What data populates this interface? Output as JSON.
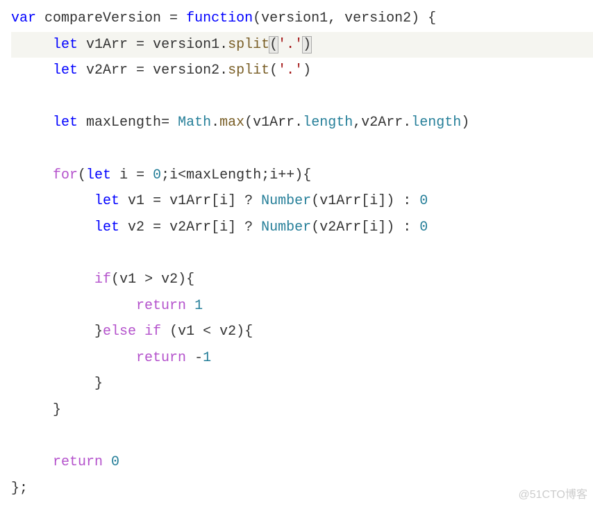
{
  "watermark": "@51CTO博客",
  "code": [
    {
      "indent": 0,
      "segs": [
        {
          "cls": "kw-var",
          "t": "var"
        },
        {
          "cls": "ident",
          "t": " compareVersion "
        },
        {
          "cls": "op",
          "t": "="
        },
        {
          "cls": "ident",
          "t": " "
        },
        {
          "cls": "kw-function",
          "t": "function"
        },
        {
          "cls": "paren",
          "t": "("
        },
        {
          "cls": "ident",
          "t": "version1"
        },
        {
          "cls": "punct",
          "t": ", "
        },
        {
          "cls": "ident",
          "t": "version2"
        },
        {
          "cls": "paren",
          "t": ") "
        },
        {
          "cls": "brace",
          "t": "{"
        }
      ]
    },
    {
      "indent": 1,
      "hl": true,
      "segs": [
        {
          "cls": "kw-let",
          "t": "let"
        },
        {
          "cls": "ident",
          "t": " v1Arr "
        },
        {
          "cls": "op",
          "t": "="
        },
        {
          "cls": "ident",
          "t": " version1"
        },
        {
          "cls": "punct",
          "t": "."
        },
        {
          "cls": "method",
          "t": "split"
        },
        {
          "cls": "paren hlp",
          "t": "("
        },
        {
          "cls": "str",
          "t": "'.'"
        },
        {
          "cls": "paren hlp",
          "t": ")"
        }
      ]
    },
    {
      "indent": 1,
      "segs": [
        {
          "cls": "kw-let",
          "t": "let"
        },
        {
          "cls": "ident",
          "t": " v2Arr "
        },
        {
          "cls": "op",
          "t": "="
        },
        {
          "cls": "ident",
          "t": " version2"
        },
        {
          "cls": "punct",
          "t": "."
        },
        {
          "cls": "method",
          "t": "split"
        },
        {
          "cls": "paren",
          "t": "("
        },
        {
          "cls": "str",
          "t": "'.'"
        },
        {
          "cls": "paren",
          "t": ")"
        }
      ]
    },
    {
      "indent": 0,
      "segs": [
        {
          "cls": "",
          "t": " "
        }
      ]
    },
    {
      "indent": 1,
      "segs": [
        {
          "cls": "kw-let",
          "t": "let"
        },
        {
          "cls": "ident",
          "t": " maxLength"
        },
        {
          "cls": "op",
          "t": "="
        },
        {
          "cls": "ident",
          "t": " "
        },
        {
          "cls": "var",
          "t": "Math"
        },
        {
          "cls": "punct",
          "t": "."
        },
        {
          "cls": "method",
          "t": "max"
        },
        {
          "cls": "paren",
          "t": "("
        },
        {
          "cls": "ident",
          "t": "v1Arr"
        },
        {
          "cls": "punct",
          "t": "."
        },
        {
          "cls": "prop",
          "t": "length"
        },
        {
          "cls": "punct",
          "t": ","
        },
        {
          "cls": "ident",
          "t": "v2Arr"
        },
        {
          "cls": "punct",
          "t": "."
        },
        {
          "cls": "prop",
          "t": "length"
        },
        {
          "cls": "paren",
          "t": ")"
        }
      ]
    },
    {
      "indent": 0,
      "segs": [
        {
          "cls": "",
          "t": " "
        }
      ]
    },
    {
      "indent": 1,
      "segs": [
        {
          "cls": "kw-for",
          "t": "for"
        },
        {
          "cls": "paren",
          "t": "("
        },
        {
          "cls": "kw-let",
          "t": "let"
        },
        {
          "cls": "ident",
          "t": " i "
        },
        {
          "cls": "op",
          "t": "="
        },
        {
          "cls": "ident",
          "t": " "
        },
        {
          "cls": "num",
          "t": "0"
        },
        {
          "cls": "punct",
          "t": ";"
        },
        {
          "cls": "ident",
          "t": "i"
        },
        {
          "cls": "op",
          "t": "<"
        },
        {
          "cls": "ident",
          "t": "maxLength"
        },
        {
          "cls": "punct",
          "t": ";"
        },
        {
          "cls": "ident",
          "t": "i"
        },
        {
          "cls": "op",
          "t": "++"
        },
        {
          "cls": "paren",
          "t": ")"
        },
        {
          "cls": "brace",
          "t": "{"
        }
      ]
    },
    {
      "indent": 2,
      "segs": [
        {
          "cls": "kw-let",
          "t": "let"
        },
        {
          "cls": "ident",
          "t": " v1 "
        },
        {
          "cls": "op",
          "t": "="
        },
        {
          "cls": "ident",
          "t": " v1Arr"
        },
        {
          "cls": "paren",
          "t": "["
        },
        {
          "cls": "ident",
          "t": "i"
        },
        {
          "cls": "paren",
          "t": "] "
        },
        {
          "cls": "op",
          "t": "?"
        },
        {
          "cls": "ident",
          "t": " "
        },
        {
          "cls": "func-call",
          "t": "Number"
        },
        {
          "cls": "paren",
          "t": "("
        },
        {
          "cls": "ident",
          "t": "v1Arr"
        },
        {
          "cls": "paren",
          "t": "["
        },
        {
          "cls": "ident",
          "t": "i"
        },
        {
          "cls": "paren",
          "t": "]) "
        },
        {
          "cls": "op",
          "t": ":"
        },
        {
          "cls": "ident",
          "t": " "
        },
        {
          "cls": "num",
          "t": "0"
        }
      ]
    },
    {
      "indent": 2,
      "segs": [
        {
          "cls": "kw-let",
          "t": "let"
        },
        {
          "cls": "ident",
          "t": " v2 "
        },
        {
          "cls": "op",
          "t": "="
        },
        {
          "cls": "ident",
          "t": " v2Arr"
        },
        {
          "cls": "paren",
          "t": "["
        },
        {
          "cls": "ident",
          "t": "i"
        },
        {
          "cls": "paren",
          "t": "] "
        },
        {
          "cls": "op",
          "t": "?"
        },
        {
          "cls": "ident",
          "t": " "
        },
        {
          "cls": "func-call",
          "t": "Number"
        },
        {
          "cls": "paren",
          "t": "("
        },
        {
          "cls": "ident",
          "t": "v2Arr"
        },
        {
          "cls": "paren",
          "t": "["
        },
        {
          "cls": "ident",
          "t": "i"
        },
        {
          "cls": "paren",
          "t": "]) "
        },
        {
          "cls": "op",
          "t": ":"
        },
        {
          "cls": "ident",
          "t": " "
        },
        {
          "cls": "num",
          "t": "0"
        }
      ]
    },
    {
      "indent": 0,
      "segs": [
        {
          "cls": "",
          "t": " "
        }
      ]
    },
    {
      "indent": 2,
      "segs": [
        {
          "cls": "kw-if",
          "t": "if"
        },
        {
          "cls": "paren",
          "t": "("
        },
        {
          "cls": "ident",
          "t": "v1 "
        },
        {
          "cls": "op",
          "t": ">"
        },
        {
          "cls": "ident",
          "t": " v2"
        },
        {
          "cls": "paren",
          "t": ")"
        },
        {
          "cls": "brace",
          "t": "{"
        }
      ]
    },
    {
      "indent": 3,
      "segs": [
        {
          "cls": "kw-return",
          "t": "return"
        },
        {
          "cls": "ident",
          "t": " "
        },
        {
          "cls": "num",
          "t": "1"
        }
      ]
    },
    {
      "indent": 2,
      "segs": [
        {
          "cls": "brace",
          "t": "}"
        },
        {
          "cls": "kw-else",
          "t": "else"
        },
        {
          "cls": "ident",
          "t": " "
        },
        {
          "cls": "kw-if",
          "t": "if"
        },
        {
          "cls": "ident",
          "t": " "
        },
        {
          "cls": "paren",
          "t": "("
        },
        {
          "cls": "ident",
          "t": "v1 "
        },
        {
          "cls": "op",
          "t": "<"
        },
        {
          "cls": "ident",
          "t": " v2"
        },
        {
          "cls": "paren",
          "t": ")"
        },
        {
          "cls": "brace",
          "t": "{"
        }
      ]
    },
    {
      "indent": 3,
      "segs": [
        {
          "cls": "kw-return",
          "t": "return"
        },
        {
          "cls": "ident",
          "t": " "
        },
        {
          "cls": "op",
          "t": "-"
        },
        {
          "cls": "num",
          "t": "1"
        }
      ]
    },
    {
      "indent": 2,
      "segs": [
        {
          "cls": "brace",
          "t": "}"
        }
      ]
    },
    {
      "indent": 1,
      "segs": [
        {
          "cls": "brace",
          "t": "}"
        }
      ]
    },
    {
      "indent": 0,
      "segs": [
        {
          "cls": "",
          "t": " "
        }
      ]
    },
    {
      "indent": 1,
      "segs": [
        {
          "cls": "kw-return",
          "t": "return"
        },
        {
          "cls": "ident",
          "t": " "
        },
        {
          "cls": "num",
          "t": "0"
        }
      ]
    },
    {
      "indent": 0,
      "segs": [
        {
          "cls": "brace",
          "t": "}"
        },
        {
          "cls": "punct",
          "t": ";"
        }
      ]
    }
  ]
}
